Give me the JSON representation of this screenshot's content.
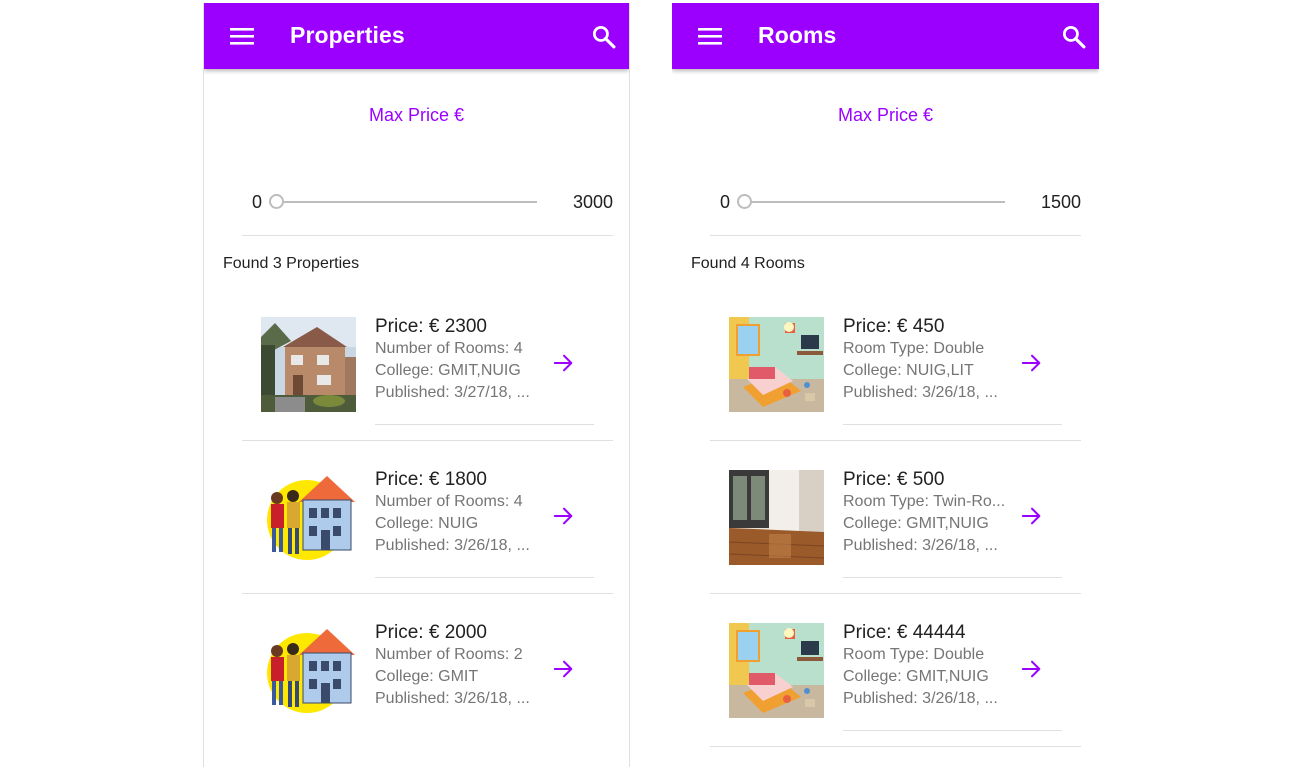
{
  "colors": {
    "accent": "#9b00ff",
    "text": "#212121",
    "secondary": "#757575",
    "divider": "#e0e0e0"
  },
  "panels": [
    {
      "title": "Properties",
      "max_price_label": "Max Price €",
      "range_min": "0",
      "range_max": "3000",
      "slider_value": 0,
      "found_text": "Found 3 Properties",
      "items": [
        {
          "price": "Price: € 2300",
          "line1": "Number of Rooms: 4",
          "line2": "College: GMIT,NUIG",
          "line3": "Published: 3/27/18, ...",
          "image": "house-photo"
        },
        {
          "price": "Price: € 1800",
          "line1": "Number of Rooms: 4",
          "line2": "College: NUIG",
          "line3": "Published: 3/26/18, ...",
          "image": "house-cartoon"
        },
        {
          "price": "Price: € 2000",
          "line1": "Number of Rooms: 2",
          "line2": "College: GMIT",
          "line3": "Published: 3/26/18, ...",
          "image": "house-cartoon"
        }
      ]
    },
    {
      "title": "Rooms",
      "max_price_label": "Max Price €",
      "range_min": "0",
      "range_max": "1500",
      "slider_value": 0,
      "found_text": "Found 4 Rooms",
      "items": [
        {
          "price": "Price: € 450",
          "line1": "Room Type: Double",
          "line2": "College: NUIG,LIT",
          "line3": "Published: 3/26/18, ...",
          "image": "room-cartoon"
        },
        {
          "price": "Price: € 500",
          "line1": "Room Type: Twin-Ro...",
          "line2": "College: GMIT,NUIG",
          "line3": "Published: 3/26/18, ...",
          "image": "room-photo"
        },
        {
          "price": "Price: € 44444",
          "line1": "Room Type: Double",
          "line2": "College: GMIT,NUIG",
          "line3": "Published: 3/26/18, ...",
          "image": "room-cartoon"
        }
      ]
    }
  ],
  "icons": {
    "menu": "menu-icon",
    "search": "search-icon",
    "arrow": "arrow-forward-icon"
  }
}
